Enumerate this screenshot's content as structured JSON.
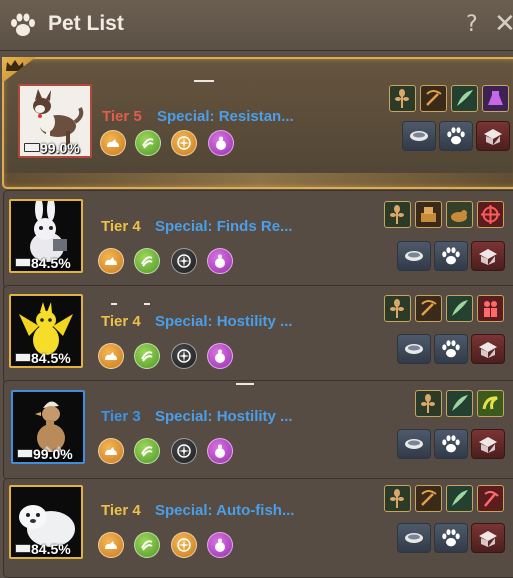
{
  "header": {
    "title": "Pet List",
    "help_label": "?",
    "close_label": "✕"
  },
  "pets": [
    {
      "tier": "Tier 5",
      "special": "Special: Resistan...",
      "percent": "99.0%",
      "frame": "red",
      "portrait": "dog-portrait",
      "traits": [
        "orange",
        "green",
        "orange",
        "purple"
      ],
      "skills": [
        "skill-wheat-icon",
        "skill-scythe-icon",
        "skill-wing-icon",
        "skill-potion-icon"
      ]
    },
    {
      "tier": "Tier 4",
      "special": "Special: Finds Re...",
      "percent": "84.5%",
      "frame": "gold",
      "portrait": "rabbit-portrait",
      "traits": [
        "orange",
        "green",
        "dark",
        "purple"
      ],
      "skills": [
        "skill-wheat-icon",
        "skill-chest-icon",
        "skill-beaver-icon",
        "skill-target-icon"
      ]
    },
    {
      "tier": "Tier 4",
      "special": "Special: Hostility ...",
      "percent": "84.5%",
      "frame": "gold",
      "portrait": "dragon-portrait",
      "traits": [
        "orange",
        "green",
        "dark",
        "purple"
      ],
      "skills": [
        "skill-wheat-icon",
        "skill-scythe-icon",
        "skill-wing-icon",
        "skill-figures-icon"
      ]
    },
    {
      "tier": "Tier 3",
      "special": "Special: Hostility ...",
      "percent": "99.0%",
      "frame": "blue",
      "portrait": "chick-portrait",
      "traits": [
        "orange",
        "green",
        "dark",
        "purple"
      ],
      "skills": [
        "skill-wheat-icon",
        "skill-wing-icon",
        "skill-swirl-icon"
      ]
    },
    {
      "tier": "Tier 4",
      "special": "Special: Auto-fish...",
      "percent": "84.5%",
      "frame": "gold",
      "portrait": "seal-portrait",
      "traits": [
        "orange",
        "green",
        "orange",
        "purple"
      ],
      "skills": [
        "skill-wheat-icon",
        "skill-scythe-icon",
        "skill-wing-icon",
        "skill-pickaxe-icon"
      ]
    }
  ],
  "colors": {
    "tier5": "#e25c4c",
    "tier4": "#eec04a",
    "tier3": "#3f93e6",
    "special": "#4b9ee8",
    "highlight": "#e0ad4e"
  }
}
